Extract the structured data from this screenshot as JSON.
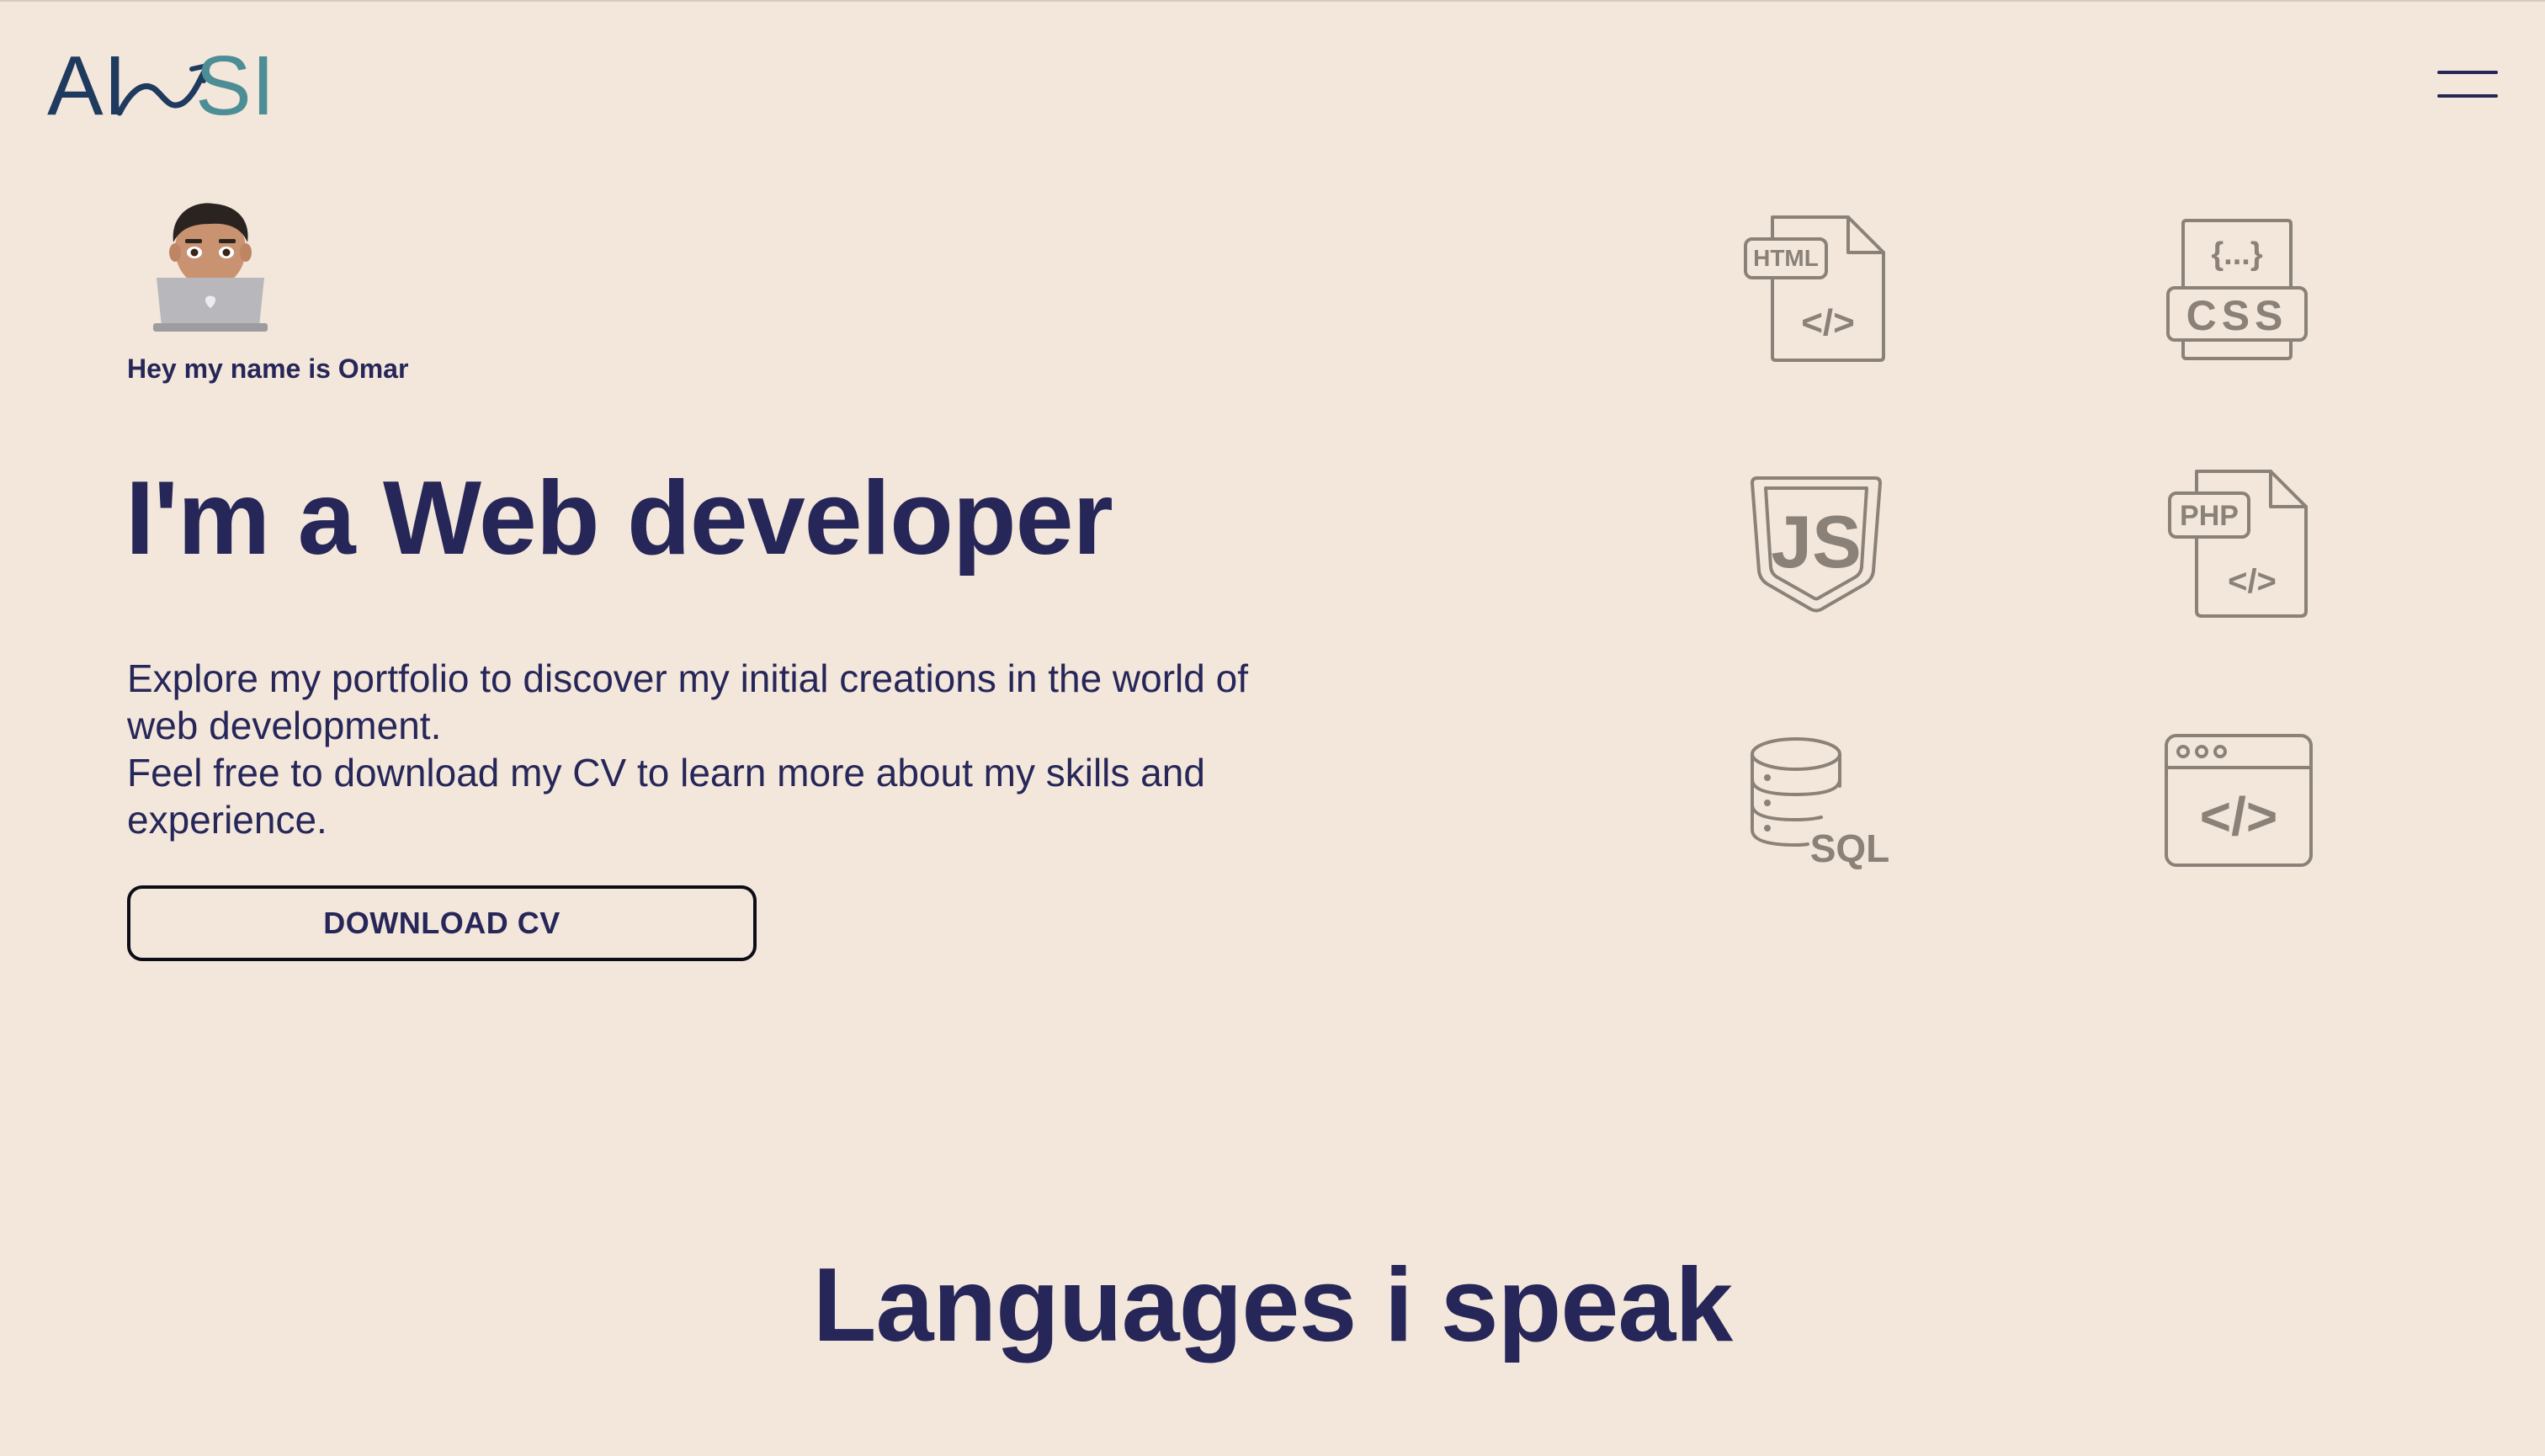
{
  "header": {
    "logo_text_left": "AI",
    "logo_text_right": "SI",
    "logo_colors": {
      "dark": "#1f3a5f",
      "teal": "#4d8d95"
    },
    "menu_icon": "hamburger-menu-icon"
  },
  "hero": {
    "avatar_icon": "memoji-laptop-avatar",
    "greeting": "Hey my name is Omar",
    "headline": "I'm a Web developer",
    "intro_lines": [
      "Explore my portfolio to discover my initial creations in the world of",
      "web development.",
      "Feel free to download my CV to learn more about my skills and",
      "experience."
    ],
    "cta_label": "DOWNLOAD CV"
  },
  "skills_icons": [
    {
      "name": "html-file-icon",
      "label": "HTML",
      "code": "</>"
    },
    {
      "name": "css-file-icon",
      "label": "CSS",
      "code": "{...}"
    },
    {
      "name": "javascript-shield-icon",
      "label": "JS"
    },
    {
      "name": "php-file-icon",
      "label": "PHP",
      "code": "</>"
    },
    {
      "name": "sql-database-icon",
      "label": "SQL"
    },
    {
      "name": "code-window-icon",
      "code": "</>"
    }
  ],
  "sections": {
    "languages_title": "Languages i speak"
  },
  "colors": {
    "background": "#f3e7db",
    "text": "#262659",
    "icon_stroke": "#8a8178",
    "button_border": "#0d0d1a"
  }
}
